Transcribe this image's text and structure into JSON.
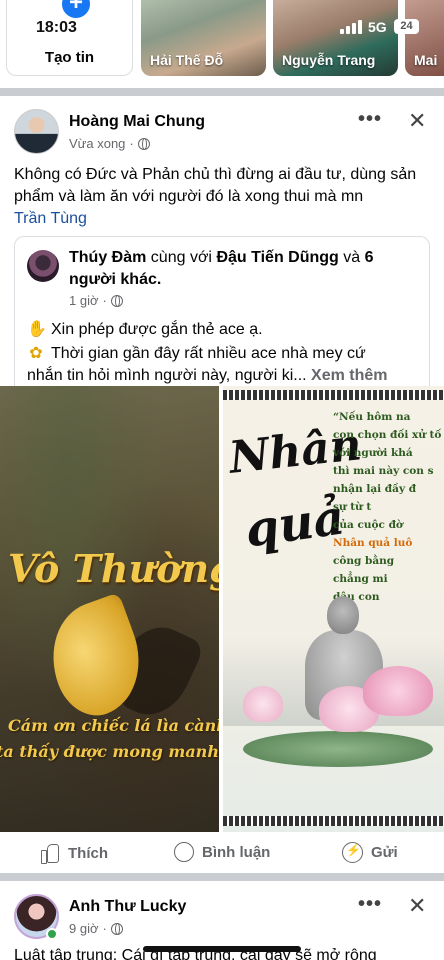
{
  "status": {
    "time": "18:03",
    "network": "5G",
    "battery": "24"
  },
  "stories": {
    "create_label": "Tạo tin",
    "items": [
      {
        "name": "Hải Thế Đỗ"
      },
      {
        "name": "Nguyễn Trang"
      },
      {
        "name": "Mai"
      }
    ]
  },
  "post": {
    "author": "Hoàng Mai Chung",
    "time": "Vừa xong",
    "text": "Không có Đức và Phản chủ thì đừng ai đầu tư, dùng sản phẩm và làm ăn với người đó là xong thui mà mn",
    "mention": "Trần Tùng",
    "shared": {
      "author": "Thúy Đàm",
      "with_text": "cùng với",
      "tagged": "Đậu Tiến Dũngg",
      "and_text": "và",
      "others": "6 người khác.",
      "time": "1 giờ",
      "line1": "Xin phép được gắn thẻ ace ạ.",
      "line2": "Thời gian gần đây rất nhiều ace nhà mey cứ",
      "line3": "nhắn tin hỏi mình người này, người ki...",
      "see_more": "Xem thêm",
      "icons": {
        "line1": "handshake-emoji",
        "line2": "sunflower-emoji"
      }
    },
    "image_left": {
      "title": "Vô Thường",
      "caption1": "Cám ơn chiếc lá lìa cành,",
      "caption2": "ta thấy được mong manh kiếp"
    },
    "image_right": {
      "title_line1": "Nhân",
      "title_line2": "quả",
      "poem": [
        "“Nếu hôm na",
        "con chọn đối xử tố",
        "với người khá",
        "thì mai này con s",
        "nhận lại đầy đ",
        "sự từ t",
        "của cuộc đờ"
      ],
      "highlight": "Nhân quả luô",
      "poem_end": [
        "công bằng",
        "chẳng mi",
        "dâu con"
      ]
    },
    "actions": {
      "like": "Thích",
      "comment": "Bình luận",
      "share": "Gửi"
    }
  },
  "post2": {
    "author": "Anh Thư Lucky",
    "time": "9 giờ",
    "text": "Luật tập trung: Cái gì tập trung, cái đấy sẽ mở rộng"
  }
}
